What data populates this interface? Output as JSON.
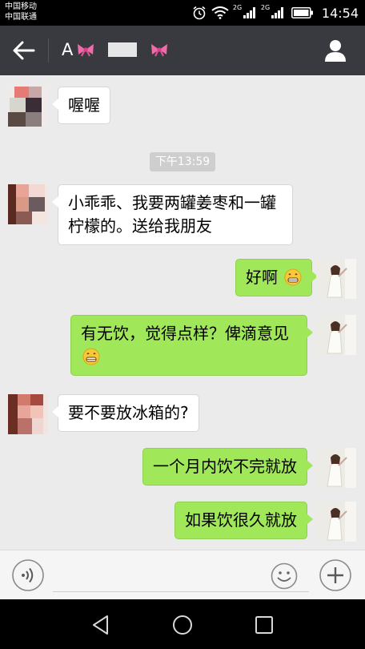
{
  "status_bar": {
    "carrier_1": "中国移动",
    "carrier_2": "中国联通",
    "network_1": "2G",
    "network_2": "2G",
    "time": "14:54",
    "icons": [
      "alarm-icon",
      "wifi-icon",
      "signal-icon",
      "signal-icon",
      "battery-icon"
    ]
  },
  "header": {
    "title_initial": "A",
    "back_icon": "arrow-left-icon",
    "contact_icon": "person-icon",
    "bow_icon": "bow-icon"
  },
  "timestamp": "下午13:59",
  "messages": [
    {
      "side": "left",
      "text": "喔喔"
    },
    {
      "side": "left",
      "text": "小乖乖、我要两罐姜枣和一罐柠檬的。送给我朋友"
    },
    {
      "side": "right",
      "text": "好啊",
      "emoji": "grin-emoji"
    },
    {
      "side": "right",
      "text": "有无饮，觉得点样？俾滴意见",
      "emoji": "grin-emoji"
    },
    {
      "side": "left",
      "text": "要不要放冰箱的?"
    },
    {
      "side": "right",
      "text": "一个月内饮不完就放"
    },
    {
      "side": "right",
      "text": "如果饮很久就放"
    }
  ],
  "input_bar": {
    "placeholder": "",
    "voice_icon": "voice-icon",
    "emoji_icon": "smiley-icon",
    "more_icon": "plus-icon"
  },
  "nav_bar": {
    "icons": [
      "nav-back-icon",
      "nav-home-icon",
      "nav-recent-icon"
    ]
  },
  "colors": {
    "header_bg": "#393a3f",
    "chat_bg": "#ebebeb",
    "bubble_sent": "#a0e75a",
    "bubble_received": "#ffffff"
  }
}
